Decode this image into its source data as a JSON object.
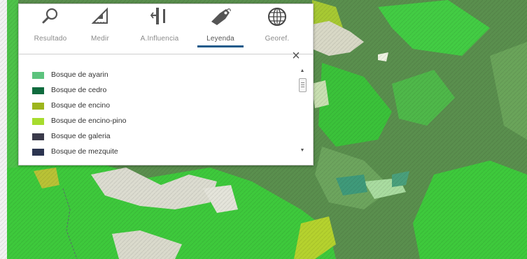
{
  "toolbar": {
    "tools": [
      {
        "label": "Resultado",
        "icon": "magnifier-icon"
      },
      {
        "label": "Medir",
        "icon": "ruler-triangle-icon"
      },
      {
        "label": "A.Influencia",
        "icon": "influence-area-icon"
      },
      {
        "label": "Leyenda",
        "icon": "tag-icon"
      },
      {
        "label": "Georef.",
        "icon": "globe-icon"
      }
    ],
    "active_tool": "Leyenda"
  },
  "close_icon": "close-icon",
  "legend": {
    "items": [
      {
        "label": "Bosque de ayarin",
        "color": "#5cc37d"
      },
      {
        "label": "Bosque de cedro",
        "color": "#0f6b3e"
      },
      {
        "label": "Bosque de encino",
        "color": "#9db51c"
      },
      {
        "label": "Bosque de encino-pino",
        "color": "#a7dc2e"
      },
      {
        "label": "Bosque de galeria",
        "color": "#3a3a4a"
      },
      {
        "label": "Bosque de mezquite",
        "color": "#2c3450"
      }
    ]
  },
  "colors": {
    "accent": "#1b5a8a",
    "map_dark_green": "#5a8f4e",
    "map_bright_green": "#3ec93c",
    "map_light_patch": "#d8d8c6"
  }
}
